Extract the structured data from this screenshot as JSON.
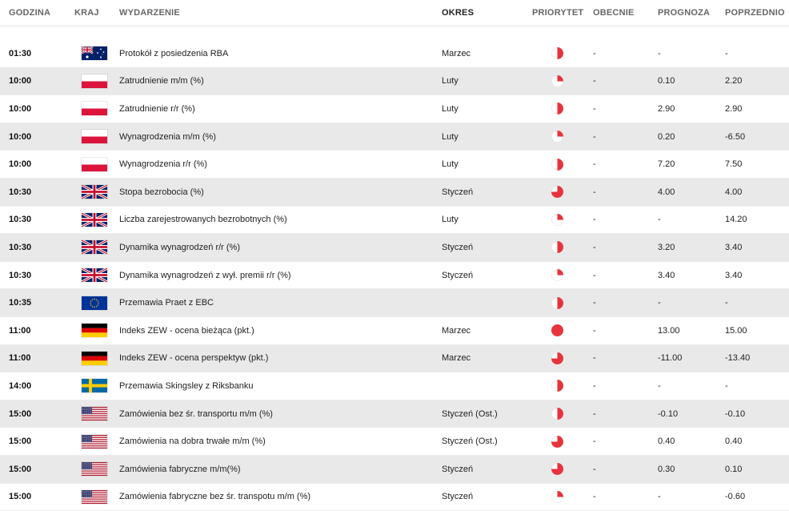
{
  "columns": {
    "time": "GODZINA",
    "country": "KRAJ",
    "event": "WYDARZENIE",
    "period": "OKRES",
    "priority": "PRIORYTET",
    "current": "OBECNIE",
    "forecast": "PROGNOZA",
    "previous": "POPRZEDNIO"
  },
  "colors": {
    "priority": "#e8333c",
    "alt_row": "#e9e9e9"
  },
  "rows": [
    {
      "time": "01:30",
      "country": "au",
      "event": "Protokół z posiedzenia RBA",
      "period": "Marzec",
      "priority": 2,
      "current": "-",
      "forecast": "-",
      "previous": "-"
    },
    {
      "time": "10:00",
      "country": "pl",
      "event": "Zatrudnienie m/m (%)",
      "period": "Luty",
      "priority": 1,
      "current": "-",
      "forecast": "0.10",
      "previous": "2.20"
    },
    {
      "time": "10:00",
      "country": "pl",
      "event": "Zatrudnienie r/r (%)",
      "period": "Luty",
      "priority": 2,
      "current": "-",
      "forecast": "2.90",
      "previous": "2.90"
    },
    {
      "time": "10:00",
      "country": "pl",
      "event": "Wynagrodzenia m/m (%)",
      "period": "Luty",
      "priority": 1,
      "current": "-",
      "forecast": "0.20",
      "previous": "-6.50"
    },
    {
      "time": "10:00",
      "country": "pl",
      "event": "Wynagrodzenia r/r (%)",
      "period": "Luty",
      "priority": 2,
      "current": "-",
      "forecast": "7.20",
      "previous": "7.50"
    },
    {
      "time": "10:30",
      "country": "gb",
      "event": "Stopa bezrobocia (%)",
      "period": "Styczeń",
      "priority": 3,
      "current": "-",
      "forecast": "4.00",
      "previous": "4.00"
    },
    {
      "time": "10:30",
      "country": "gb",
      "event": "Liczba zarejestrowanych bezrobotnych (%)",
      "period": "Luty",
      "priority": 1,
      "current": "-",
      "forecast": "-",
      "previous": "14.20"
    },
    {
      "time": "10:30",
      "country": "gb",
      "event": "Dynamika wynagrodzeń r/r (%)",
      "period": "Styczeń",
      "priority": 2,
      "current": "-",
      "forecast": "3.20",
      "previous": "3.40"
    },
    {
      "time": "10:30",
      "country": "gb",
      "event": "Dynamika wynagrodzeń z wył. premii r/r (%)",
      "period": "Styczeń",
      "priority": 1,
      "current": "-",
      "forecast": "3.40",
      "previous": "3.40"
    },
    {
      "time": "10:35",
      "country": "eu",
      "event": "Przemawia Praet z EBC",
      "period": "",
      "priority": 2,
      "current": "-",
      "forecast": "-",
      "previous": "-"
    },
    {
      "time": "11:00",
      "country": "de",
      "event": "Indeks ZEW - ocena bieżąca (pkt.)",
      "period": "Marzec",
      "priority": 4,
      "current": "-",
      "forecast": "13.00",
      "previous": "15.00"
    },
    {
      "time": "11:00",
      "country": "de",
      "event": "Indeks ZEW - ocena perspektyw (pkt.)",
      "period": "Marzec",
      "priority": 3,
      "current": "-",
      "forecast": "-11.00",
      "previous": "-13.40"
    },
    {
      "time": "14:00",
      "country": "se",
      "event": "Przemawia Skingsley z Riksbanku",
      "period": "",
      "priority": 2,
      "current": "-",
      "forecast": "-",
      "previous": "-"
    },
    {
      "time": "15:00",
      "country": "us",
      "event": "Zamówienia bez śr. transportu m/m (%)",
      "period": "Styczeń (Ost.)",
      "priority": 2,
      "current": "-",
      "forecast": "-0.10",
      "previous": "-0.10"
    },
    {
      "time": "15:00",
      "country": "us",
      "event": "Zamówienia na dobra trwałe m/m (%)",
      "period": "Styczeń (Ost.)",
      "priority": 3,
      "current": "-",
      "forecast": "0.40",
      "previous": "0.40"
    },
    {
      "time": "15:00",
      "country": "us",
      "event": "Zamówienia fabryczne m/m(%)",
      "period": "Styczeń",
      "priority": 3,
      "current": "-",
      "forecast": "0.30",
      "previous": "0.10"
    },
    {
      "time": "15:00",
      "country": "us",
      "event": "Zamówienia fabryczne bez śr. transpotu m/m (%)",
      "period": "Styczeń",
      "priority": 1,
      "current": "-",
      "forecast": "-",
      "previous": "-0.60"
    }
  ]
}
